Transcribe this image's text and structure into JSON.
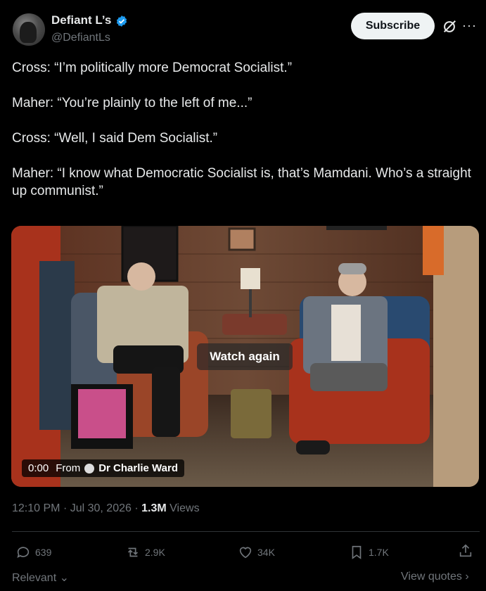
{
  "author": {
    "display_name": "Defiant L’s",
    "handle": "@DefiantLs",
    "verified_color": "#1d9bf0"
  },
  "header": {
    "subscribe_label": "Subscribe",
    "grok_icon": "grok-icon",
    "more_icon": "more-icon"
  },
  "tweet": {
    "paragraphs": [
      "Cross: “I’m politically more Democrat Socialist.”",
      "Maher: “You’re plainly to the left of me...”",
      "Cross: “Well, I said Dem Socialist.”",
      "Maher: “I know what Democratic Socialist is, that’s Mamdani. Who’s a straight up communist.”"
    ]
  },
  "video": {
    "watch_again_label": "Watch again",
    "time": "0:00",
    "from_label": "From",
    "source": "Dr Charlie Ward"
  },
  "meta": {
    "time": "12:10 PM",
    "date": "Jul 30, 2026",
    "views_count": "1.3M",
    "views_label": "Views"
  },
  "actions": {
    "replies": "639",
    "reposts": "2.9K",
    "likes": "34K",
    "bookmarks": "1.7K"
  },
  "footer": {
    "sort_label": "Relevant",
    "view_quotes_label": "View quotes"
  }
}
